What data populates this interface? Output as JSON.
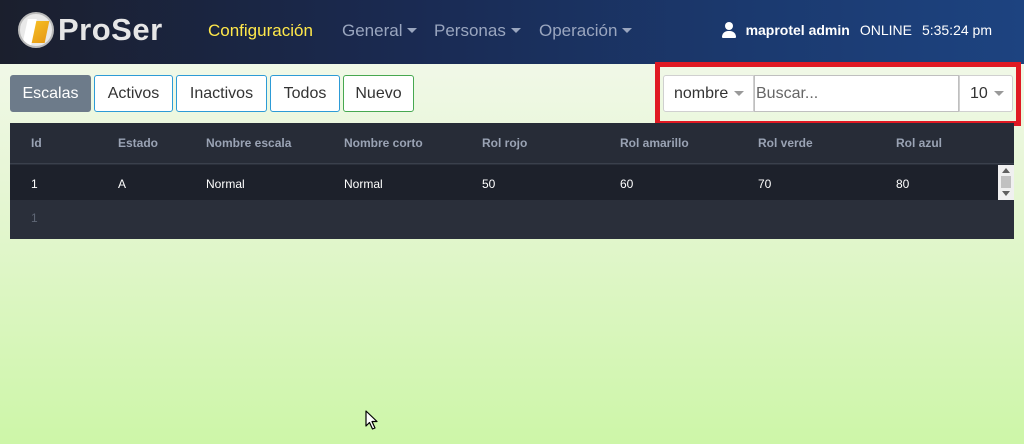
{
  "navbar": {
    "brand": "ProSer",
    "items": [
      {
        "label": "Configuración",
        "active": true
      },
      {
        "label": "General"
      },
      {
        "label": "Personas"
      },
      {
        "label": "Operación"
      }
    ],
    "user": {
      "name": "maprotel admin",
      "status": "ONLINE",
      "time": "5:35:24 pm"
    }
  },
  "filters": {
    "escalas": "Escalas",
    "activos": "Activos",
    "inactivos": "Inactivos",
    "todos": "Todos",
    "nuevo": "Nuevo"
  },
  "search": {
    "field": "nombre",
    "placeholder": "Buscar...",
    "value": "",
    "page_size": "10"
  },
  "table": {
    "columns": [
      "Id",
      "Estado",
      "Nombre escala",
      "Nombre corto",
      "Rol rojo",
      "Rol amarillo",
      "Rol verde",
      "Rol azul"
    ],
    "rows": [
      [
        "1",
        "A",
        "Normal",
        "Normal",
        "50",
        "60",
        "70",
        "80"
      ]
    ],
    "page": "1"
  },
  "colors": {
    "nav_active": "#ffe84a",
    "highlight_border": "#e01a23",
    "grid_bg": "#2a2f3a",
    "active_filter": "#6d7b8a"
  }
}
